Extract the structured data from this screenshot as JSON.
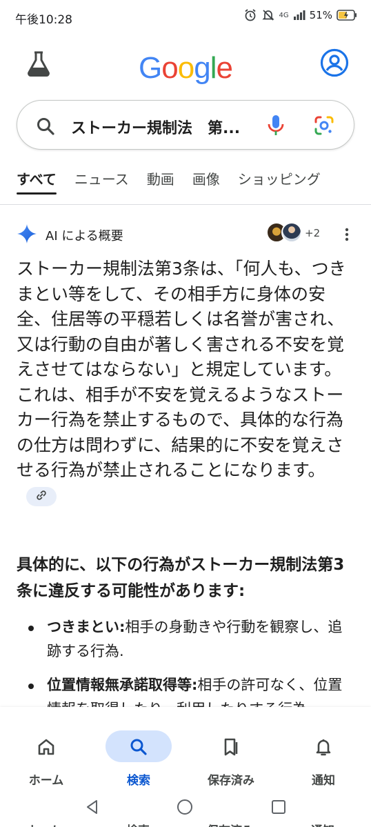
{
  "status_bar": {
    "time": "午後10:28",
    "network": "4G",
    "battery": "51%"
  },
  "header": {
    "logo_letters": [
      {
        "char": "G",
        "color": "#4285F4"
      },
      {
        "char": "o",
        "color": "#EA4335"
      },
      {
        "char": "o",
        "color": "#FBBC05"
      },
      {
        "char": "g",
        "color": "#4285F4"
      },
      {
        "char": "l",
        "color": "#34A853"
      },
      {
        "char": "e",
        "color": "#EA4335"
      }
    ]
  },
  "search": {
    "query": "ストーカー規制法　第..."
  },
  "tabs": [
    {
      "label": "すべて",
      "active": true
    },
    {
      "label": "ニュース",
      "active": false
    },
    {
      "label": "動画",
      "active": false
    },
    {
      "label": "画像",
      "active": false
    },
    {
      "label": "ショッピング",
      "active": false
    }
  ],
  "ai_overview": {
    "title": "AI による概要",
    "more_sources": "+2",
    "body": "ストーカー規制法第3条は、「何人も、つきまとい等をして、その相手方に身体の安全、住居等の平穏若しくは名誉が害され、又は行動の自由が著しく害される不安を覚えさせてはならない」と規定しています。これは、相手が不安を覚えるようなストーカー行為を禁止するもので、具体的な行為の仕方は問わずに、結果的に不安を覚えさせる行為が禁止されることになります。",
    "sub_heading": "具体的に、以下の行為がストーカー規制法第3条に違反する可能性があります:",
    "bullets": [
      {
        "term": "つきまとい:",
        "text": "相手の身動きや行動を観察し、追跡する行為."
      },
      {
        "term": "位置情報無承諾取得等:",
        "text": "相手の許可なく、位置情報を取得したり、利用したりする行為."
      }
    ]
  },
  "bottom_nav": [
    {
      "label": "ホーム",
      "icon": "home-icon",
      "active": false
    },
    {
      "label": "検索",
      "icon": "search-icon",
      "active": true
    },
    {
      "label": "保存済み",
      "icon": "saved-icon",
      "active": false
    },
    {
      "label": "通知",
      "icon": "bell-icon",
      "active": false
    }
  ],
  "colors": {
    "accent": "#0b57d0",
    "active_pill": "#d3e3fd",
    "link_chip": "#e8eef9"
  }
}
